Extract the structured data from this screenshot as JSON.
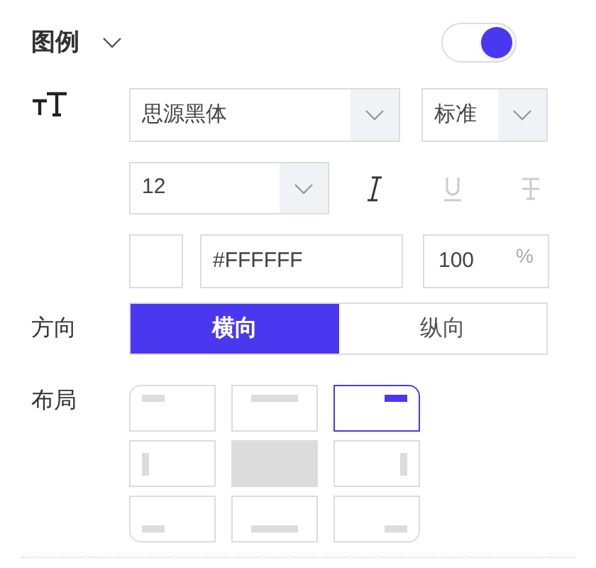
{
  "header": {
    "title": "图例",
    "expanded": true,
    "on": true
  },
  "font": {
    "family": "思源黑体",
    "weight": "标准",
    "size": "12",
    "styles": [
      {
        "kind": "italic",
        "on": true
      },
      {
        "kind": "underline",
        "on": false
      },
      {
        "kind": "strikethrough",
        "on": false
      }
    ],
    "color": "#FFFFFF",
    "opacity": "100",
    "opacity_unit": "%"
  },
  "direction": {
    "label": "方向",
    "options": [
      {
        "label": "横向",
        "selected": true
      },
      {
        "label": "纵向",
        "selected": false
      }
    ]
  },
  "layout": {
    "label": "布局",
    "positions": [
      {
        "kind": "top-left",
        "selected": false
      },
      {
        "kind": "top-center",
        "selected": false
      },
      {
        "kind": "top-right",
        "selected": true
      },
      {
        "kind": "middle-left",
        "selected": false
      },
      {
        "kind": "center",
        "selected": false
      },
      {
        "kind": "middle-right",
        "selected": false
      },
      {
        "kind": "bottom-left",
        "selected": false
      },
      {
        "kind": "bottom-center",
        "selected": false
      },
      {
        "kind": "bottom-right",
        "selected": false
      }
    ]
  }
}
